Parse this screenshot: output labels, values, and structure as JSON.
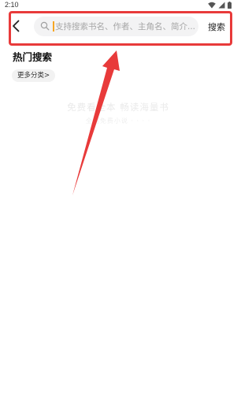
{
  "status_bar": {
    "time": "2:10"
  },
  "header": {
    "search_placeholder": "支持搜索书名、作者、主角名、简介...",
    "search_button": "搜索"
  },
  "hot_search": {
    "title": "热门搜索",
    "more_label": "更多分类>"
  },
  "watermark": {
    "line1": "免费看全本 畅读海量书",
    "line2": "全网免费小说 · · · ·"
  },
  "colors": {
    "annotation": "#e83a3a",
    "cursor": "#f6a623",
    "search_bg": "#f3f3f4"
  }
}
